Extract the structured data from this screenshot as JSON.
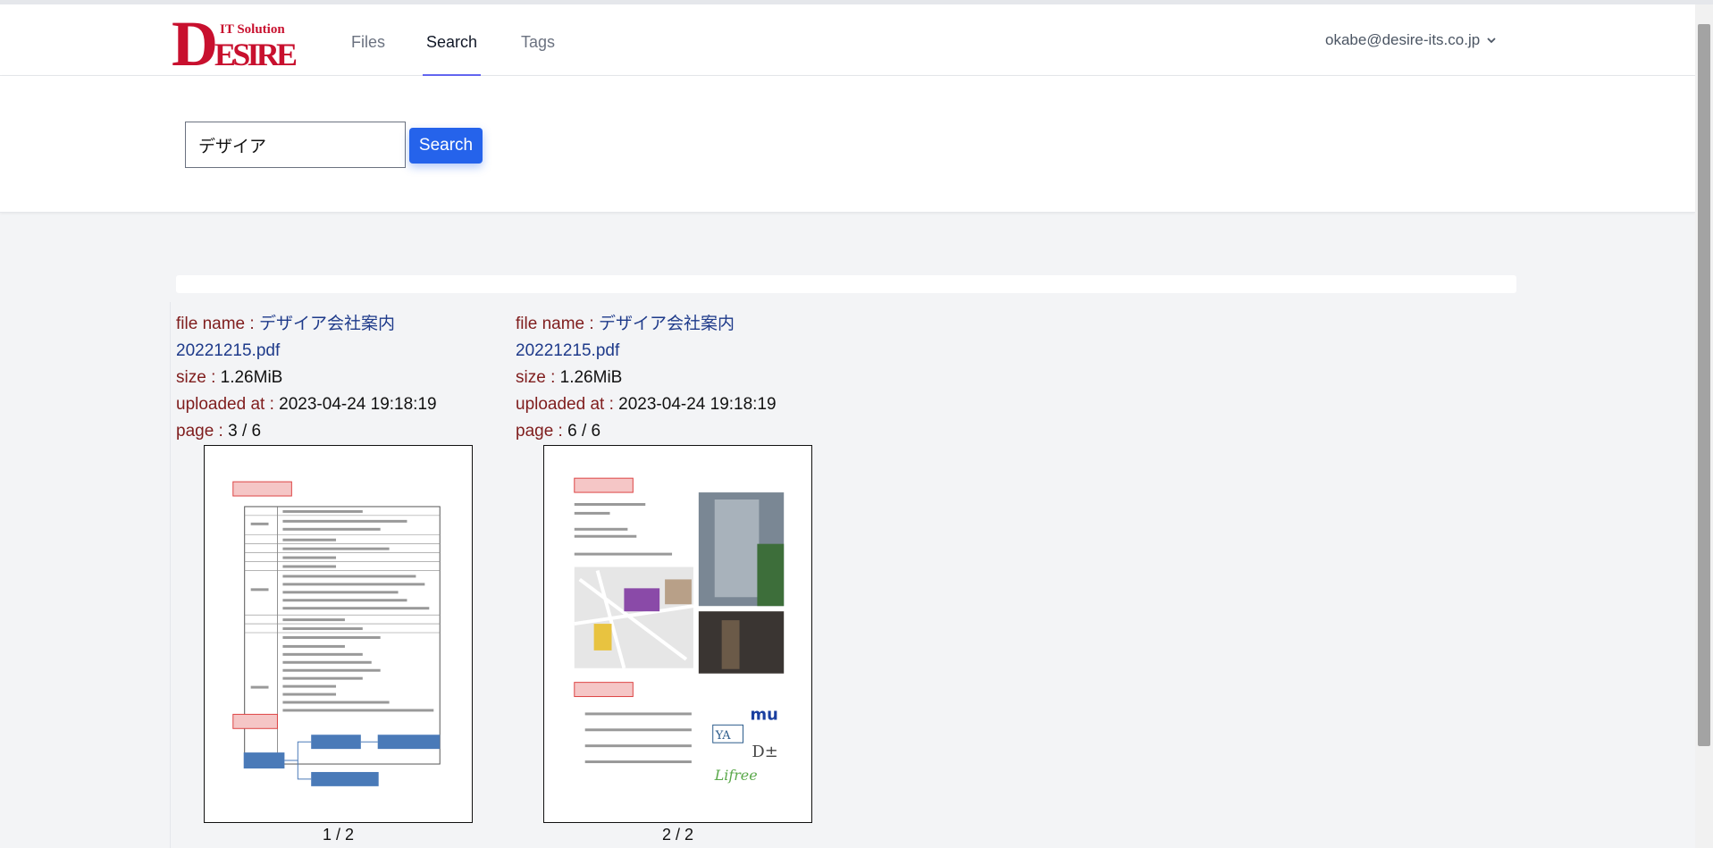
{
  "brand": {
    "logo_main": "DESIRE",
    "logo_sub": "IT Solution",
    "logo_color": "#c8102e"
  },
  "nav": {
    "files": "Files",
    "search": "Search",
    "tags": "Tags",
    "user_email": "okabe@desire-its.co.jp"
  },
  "search": {
    "query": "デザイア",
    "button_label": "Search"
  },
  "labels": {
    "file_name": "file name :",
    "size": "size :",
    "uploaded_at": "uploaded at :",
    "page": "page :"
  },
  "results": [
    {
      "file_name_line1": "デザイア会社案内",
      "file_name_line2": "20221215.pdf",
      "size": "1.26MiB",
      "uploaded_at": "2023-04-24 19:18:19",
      "page": "3 / 6",
      "pager": "1 / 2"
    },
    {
      "file_name_line1": "デザイア会社案内",
      "file_name_line2": "20221215.pdf",
      "size": "1.26MiB",
      "uploaded_at": "2023-04-24 19:18:19",
      "page": "6 / 6",
      "pager": "2 / 2"
    }
  ],
  "colors": {
    "accent": "#2563eb",
    "active_tab": "#6366f1",
    "label": "#7f1d1d",
    "filename": "#1e3a8a"
  }
}
